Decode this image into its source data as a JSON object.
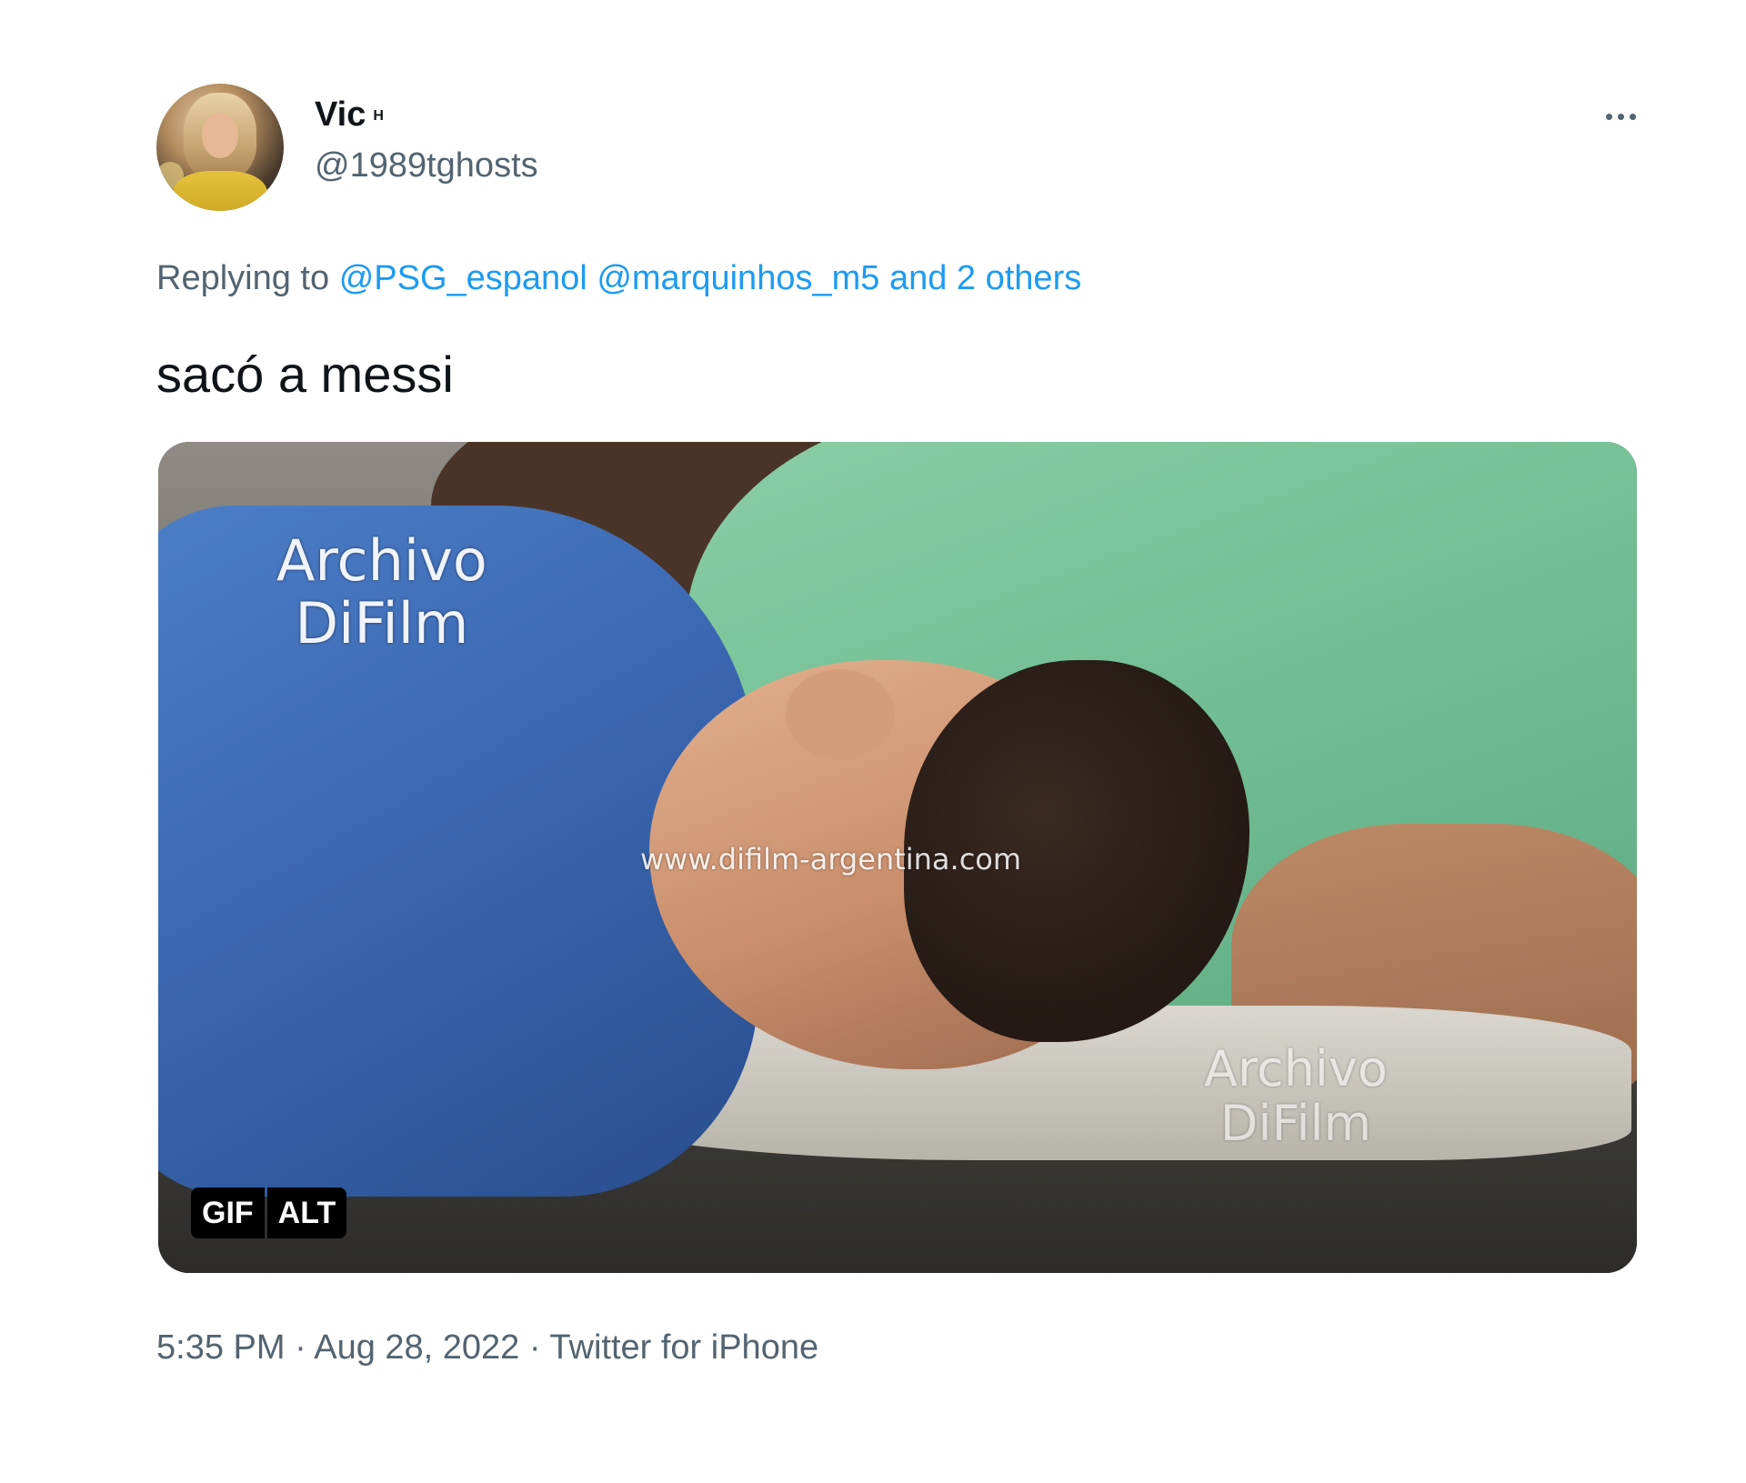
{
  "tweet": {
    "author": {
      "display_name": "Vic",
      "name_superscript": "H",
      "handle": "@1989tghosts"
    },
    "more_icon": "more-horizontal-icon",
    "reply_context": {
      "prefix": "Replying to",
      "mention_1": "@PSG_espanol",
      "mention_2": "@marquinhos_m5",
      "others": "and 2 others"
    },
    "text": "sacó a messi",
    "media": {
      "type": "gif",
      "watermark_top_line1": "Archivo",
      "watermark_top_line2": "DiFilm",
      "watermark_url": "www.difilm-argentina.com",
      "watermark_bottom_line1": "Archivo",
      "watermark_bottom_line2": "DiFilm",
      "badge_gif": "GIF",
      "badge_alt": "ALT"
    },
    "meta": {
      "time": "5:35 PM",
      "separator": "·",
      "date": "Aug 28, 2022",
      "source": "Twitter for iPhone"
    }
  },
  "colors": {
    "text_primary": "#0f1419",
    "text_secondary": "#536471",
    "link": "#1d9bf0",
    "background": "#ffffff"
  }
}
